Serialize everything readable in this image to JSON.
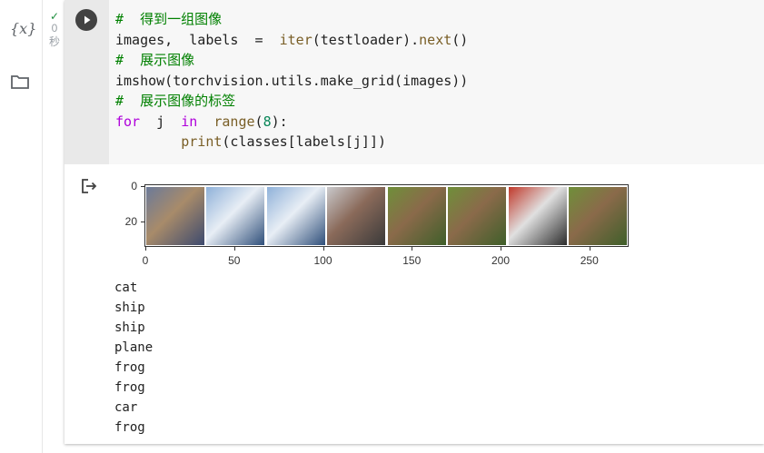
{
  "sidebar": {
    "variables_icon": "variables-icon",
    "variables_glyph": "{x}",
    "files_icon": "folder-icon"
  },
  "cell": {
    "exec_status": {
      "icon": "check-icon",
      "time_value": "0",
      "time_unit": "秒"
    },
    "run_icon": "play-icon",
    "code_lines": [
      {
        "tokens": [
          {
            "t": "#  得到一组图像",
            "c": "comment"
          }
        ]
      },
      {
        "tokens": [
          {
            "t": "images,  labels  =  ",
            "c": ""
          },
          {
            "t": "iter",
            "c": "builtin"
          },
          {
            "t": "(testloader).",
            "c": ""
          },
          {
            "t": "next",
            "c": "builtin"
          },
          {
            "t": "()",
            "c": ""
          }
        ]
      },
      {
        "tokens": [
          {
            "t": "#  展示图像",
            "c": "comment"
          }
        ]
      },
      {
        "tokens": [
          {
            "t": "imshow(torchvision.utils.make_grid(images))",
            "c": ""
          }
        ]
      },
      {
        "tokens": [
          {
            "t": "#  展示图像的标签",
            "c": "comment"
          }
        ]
      },
      {
        "tokens": [
          {
            "t": "for",
            "c": "kw"
          },
          {
            "t": "  j  ",
            "c": ""
          },
          {
            "t": "in",
            "c": "kw"
          },
          {
            "t": "  ",
            "c": ""
          },
          {
            "t": "range",
            "c": "builtin"
          },
          {
            "t": "(",
            "c": ""
          },
          {
            "t": "8",
            "c": "num"
          },
          {
            "t": "):",
            "c": ""
          }
        ]
      },
      {
        "tokens": [
          {
            "t": "        ",
            "c": ""
          },
          {
            "t": "print",
            "c": "builtin"
          },
          {
            "t": "(classes[labels[j]])",
            "c": ""
          }
        ]
      }
    ]
  },
  "output": {
    "icon": "output-redirect-icon",
    "plot": {
      "x_ticks": [
        "0",
        "50",
        "100",
        "150",
        "200",
        "250"
      ],
      "y_ticks": [
        "0",
        "20"
      ],
      "images": [
        "cat",
        "ship",
        "ship",
        "plane",
        "frog",
        "frog",
        "car",
        "frog"
      ]
    },
    "printed_labels": [
      "cat",
      "ship",
      "ship",
      "plane",
      "frog",
      "frog",
      "car",
      "frog"
    ]
  },
  "colors": {
    "comment": "#008000",
    "keyword": "#af00db",
    "builtin": "#795e26",
    "number": "#098658",
    "run_button": "#424242",
    "check": "#1e8e3e"
  }
}
